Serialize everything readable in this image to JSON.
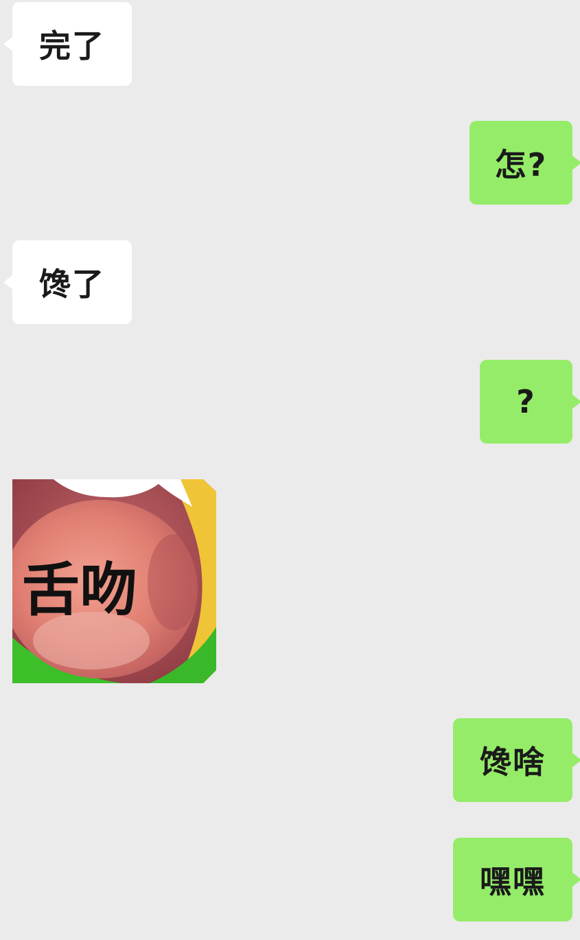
{
  "messages": [
    {
      "side": "in",
      "text": "完了"
    },
    {
      "side": "out",
      "text": "怎?"
    },
    {
      "side": "in",
      "text": "馋了"
    },
    {
      "side": "out",
      "text": "?"
    },
    {
      "side": "in",
      "type": "sticker",
      "sticker_text": "舌吻"
    },
    {
      "side": "out",
      "text": "馋啥"
    },
    {
      "side": "out",
      "text": "嘿嘿"
    }
  ],
  "colors": {
    "background": "#ebebeb",
    "incoming_bubble": "#ffffff",
    "outgoing_bubble": "#95ec69"
  }
}
